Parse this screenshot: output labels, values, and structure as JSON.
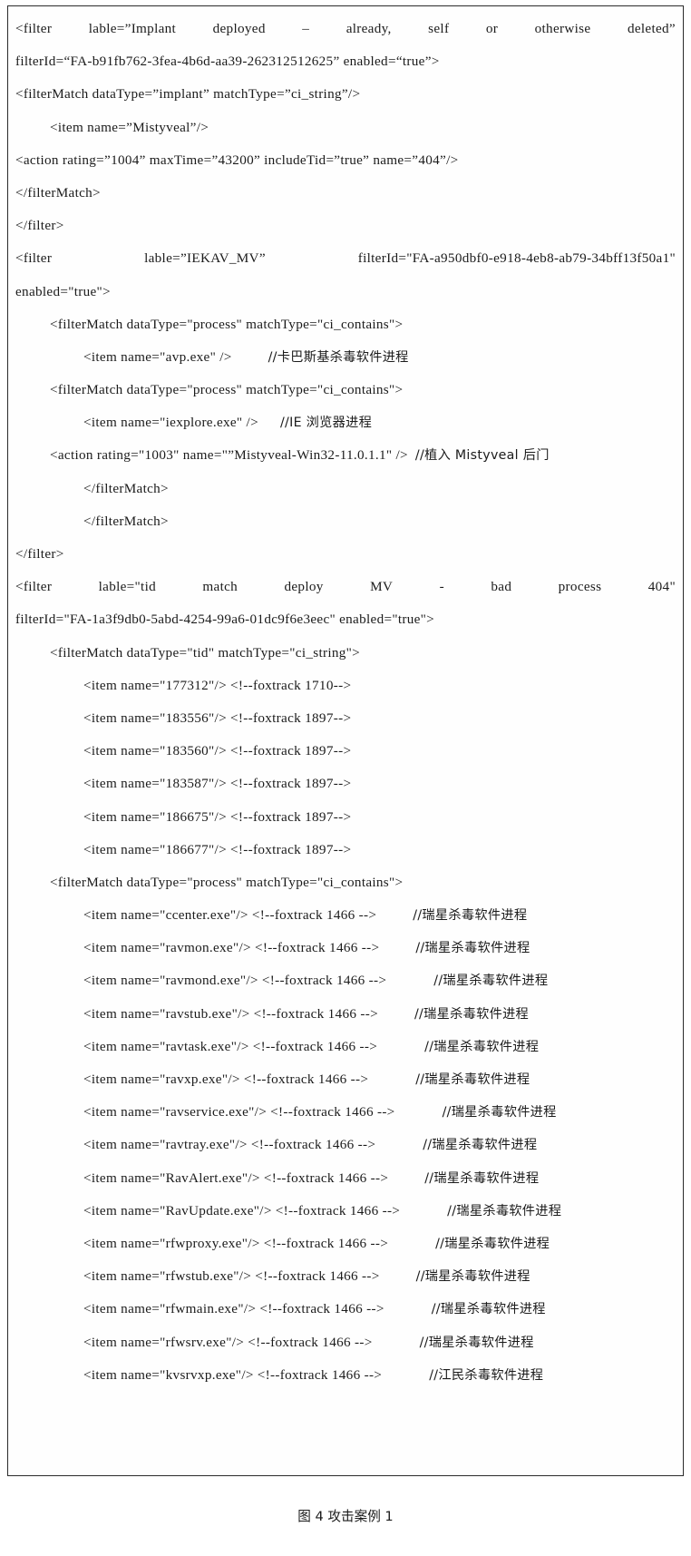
{
  "document": {
    "type": "patent-figure-code-listing",
    "caption": "图 4 攻击案例 1",
    "caption_prefix": "图 4",
    "caption_text": "攻击案例 1"
  },
  "code": {
    "lines": [
      {
        "id": "l01",
        "indent": 0,
        "justify": true,
        "parts": [
          "<filter",
          "lable=”Implant",
          "deployed",
          "–",
          "already,",
          "self",
          "or",
          "otherwise",
          "deleted”"
        ]
      },
      {
        "id": "l02",
        "indent": 0,
        "text": "filterId=“FA-b91fb762-3fea-4b6d-aa39-262312512625” enabled=“true”>"
      },
      {
        "id": "l03",
        "indent": 0,
        "text": "<filterMatch dataType=”implant” matchType=”ci_string”/>"
      },
      {
        "id": "l04",
        "indent": 1,
        "text": "<item name=”Mistyveal”/>"
      },
      {
        "id": "l05",
        "indent": 0,
        "text": "<action rating=”1004” maxTime=”43200” includeTid=”true” name=”404”/>"
      },
      {
        "id": "l06",
        "indent": 0,
        "text": "</filterMatch>"
      },
      {
        "id": "l07",
        "indent": 0,
        "text": "</filter>"
      },
      {
        "id": "l08",
        "indent": 0,
        "justify": true,
        "parts": [
          "<filter",
          "lable=”IEKAV_MV”",
          "filterId=\"FA-a950dbf0-e918-4eb8-ab79-34bff13f50a1\""
        ]
      },
      {
        "id": "l09",
        "indent": 0,
        "text": "enabled=\"true\">"
      },
      {
        "id": "l10",
        "indent": 1,
        "text": "<filterMatch dataType=\"process\" matchType=\"ci_contains\">"
      },
      {
        "id": "l11",
        "indent": 2,
        "text": "<item name=\"avp.exe\" />",
        "comment": "//卡巴斯基杀毒软件进程",
        "gap": "cmt-w"
      },
      {
        "id": "l12",
        "indent": 1,
        "text": "<filterMatch dataType=\"process\" matchType=\"ci_contains\">"
      },
      {
        "id": "l13",
        "indent": 2,
        "text": "<item name=\"iexplore.exe\" />",
        "comment": "//IE 浏览器进程",
        "gap": "cmt"
      },
      {
        "id": "l14",
        "indent": 1,
        "text": "<action rating=\"1003\" name=\"”Mistyveal-Win32-11.0.1.1\" />",
        "comment": "//植入 Mistyveal 后门",
        "gap": "cmt-t"
      },
      {
        "id": "l15",
        "indent": 2,
        "text": "</filterMatch>"
      },
      {
        "id": "l16",
        "indent": 2,
        "text": "</filterMatch>"
      },
      {
        "id": "l17",
        "indent": 0,
        "text": "</filter>"
      },
      {
        "id": "l18",
        "indent": 0,
        "justify": true,
        "parts": [
          "<filter",
          "lable=\"tid",
          "match",
          "deploy",
          "MV",
          "-",
          "bad",
          "process",
          "404\""
        ]
      },
      {
        "id": "l19",
        "indent": 0,
        "text": "filterId=\"FA-1a3f9db0-5abd-4254-99a6-01dc9f6e3eec\" enabled=\"true\">"
      },
      {
        "id": "l20",
        "indent": 1,
        "text": "<filterMatch dataType=\"tid\" matchType=\"ci_string\">"
      },
      {
        "id": "l21",
        "indent": 2,
        "text": "<item name=\"177312\"/> <!--foxtrack 1710-->"
      },
      {
        "id": "l22",
        "indent": 2,
        "text": "<item name=\"183556\"/> <!--foxtrack 1897-->"
      },
      {
        "id": "l23",
        "indent": 2,
        "text": "<item name=\"183560\"/> <!--foxtrack 1897-->"
      },
      {
        "id": "l24",
        "indent": 2,
        "text": "<item name=\"183587\"/> <!--foxtrack 1897-->"
      },
      {
        "id": "l25",
        "indent": 2,
        "text": "<item name=\"186675\"/> <!--foxtrack 1897-->"
      },
      {
        "id": "l26",
        "indent": 2,
        "text": "<item name=\"186677\"/> <!--foxtrack 1897-->"
      },
      {
        "id": "l27",
        "indent": 1,
        "text": "<filterMatch dataType=\"process\" matchType=\"ci_contains\">"
      },
      {
        "id": "l28",
        "indent": 2,
        "text": "<item name=\"ccenter.exe\"/> <!--foxtrack 1466 -->",
        "comment": "//瑞星杀毒软件进程",
        "gap": "cmt-w"
      },
      {
        "id": "l29",
        "indent": 2,
        "text": "<item name=\"ravmon.exe\"/> <!--foxtrack 1466 -->",
        "comment": "//瑞星杀毒软件进程",
        "gap": "cmt-w"
      },
      {
        "id": "l30",
        "indent": 2,
        "text": "<item name=\"ravmond.exe\"/> <!--foxtrack 1466 -->",
        "comment": "//瑞星杀毒软件进程",
        "gap": "cmt-xw"
      },
      {
        "id": "l31",
        "indent": 2,
        "text": "<item name=\"ravstub.exe\"/> <!--foxtrack 1466 -->",
        "comment": "//瑞星杀毒软件进程",
        "gap": "cmt-w"
      },
      {
        "id": "l32",
        "indent": 2,
        "text": "<item name=\"ravtask.exe\"/> <!--foxtrack 1466 -->",
        "comment": "//瑞星杀毒软件进程",
        "gap": "cmt-xw"
      },
      {
        "id": "l33",
        "indent": 2,
        "text": "<item name=\"ravxp.exe\"/> <!--foxtrack 1466 -->",
        "comment": "//瑞星杀毒软件进程",
        "gap": "cmt-xw"
      },
      {
        "id": "l34",
        "indent": 2,
        "text": "<item name=\"ravservice.exe\"/> <!--foxtrack 1466 -->",
        "comment": "//瑞星杀毒软件进程",
        "gap": "cmt-xw"
      },
      {
        "id": "l35",
        "indent": 2,
        "text": "<item name=\"ravtray.exe\"/> <!--foxtrack 1466 -->",
        "comment": "//瑞星杀毒软件进程",
        "gap": "cmt-xw"
      },
      {
        "id": "l36",
        "indent": 2,
        "text": "<item name=\"RavAlert.exe\"/> <!--foxtrack 1466 -->",
        "comment": "//瑞星杀毒软件进程",
        "gap": "cmt-w"
      },
      {
        "id": "l37",
        "indent": 2,
        "text": "<item name=\"RavUpdate.exe\"/> <!--foxtrack 1466 -->",
        "comment": "//瑞星杀毒软件进程",
        "gap": "cmt-xw"
      },
      {
        "id": "l38",
        "indent": 2,
        "text": "<item name=\"rfwproxy.exe\"/> <!--foxtrack 1466 -->",
        "comment": "//瑞星杀毒软件进程",
        "gap": "cmt-xw"
      },
      {
        "id": "l39",
        "indent": 2,
        "text": "<item name=\"rfwstub.exe\"/> <!--foxtrack 1466 -->",
        "comment": "//瑞星杀毒软件进程",
        "gap": "cmt-w"
      },
      {
        "id": "l40",
        "indent": 2,
        "text": "<item name=\"rfwmain.exe\"/> <!--foxtrack 1466 -->",
        "comment": "//瑞星杀毒软件进程",
        "gap": "cmt-xw"
      },
      {
        "id": "l41",
        "indent": 2,
        "text": "<item name=\"rfwsrv.exe\"/> <!--foxtrack 1466 -->",
        "comment": "//瑞星杀毒软件进程",
        "gap": "cmt-xw"
      },
      {
        "id": "l42",
        "indent": 2,
        "text": "<item name=\"kvsrvxp.exe\"/> <!--foxtrack 1466 -->",
        "comment": "//江民杀毒软件进程",
        "gap": "cmt-xw"
      }
    ]
  }
}
